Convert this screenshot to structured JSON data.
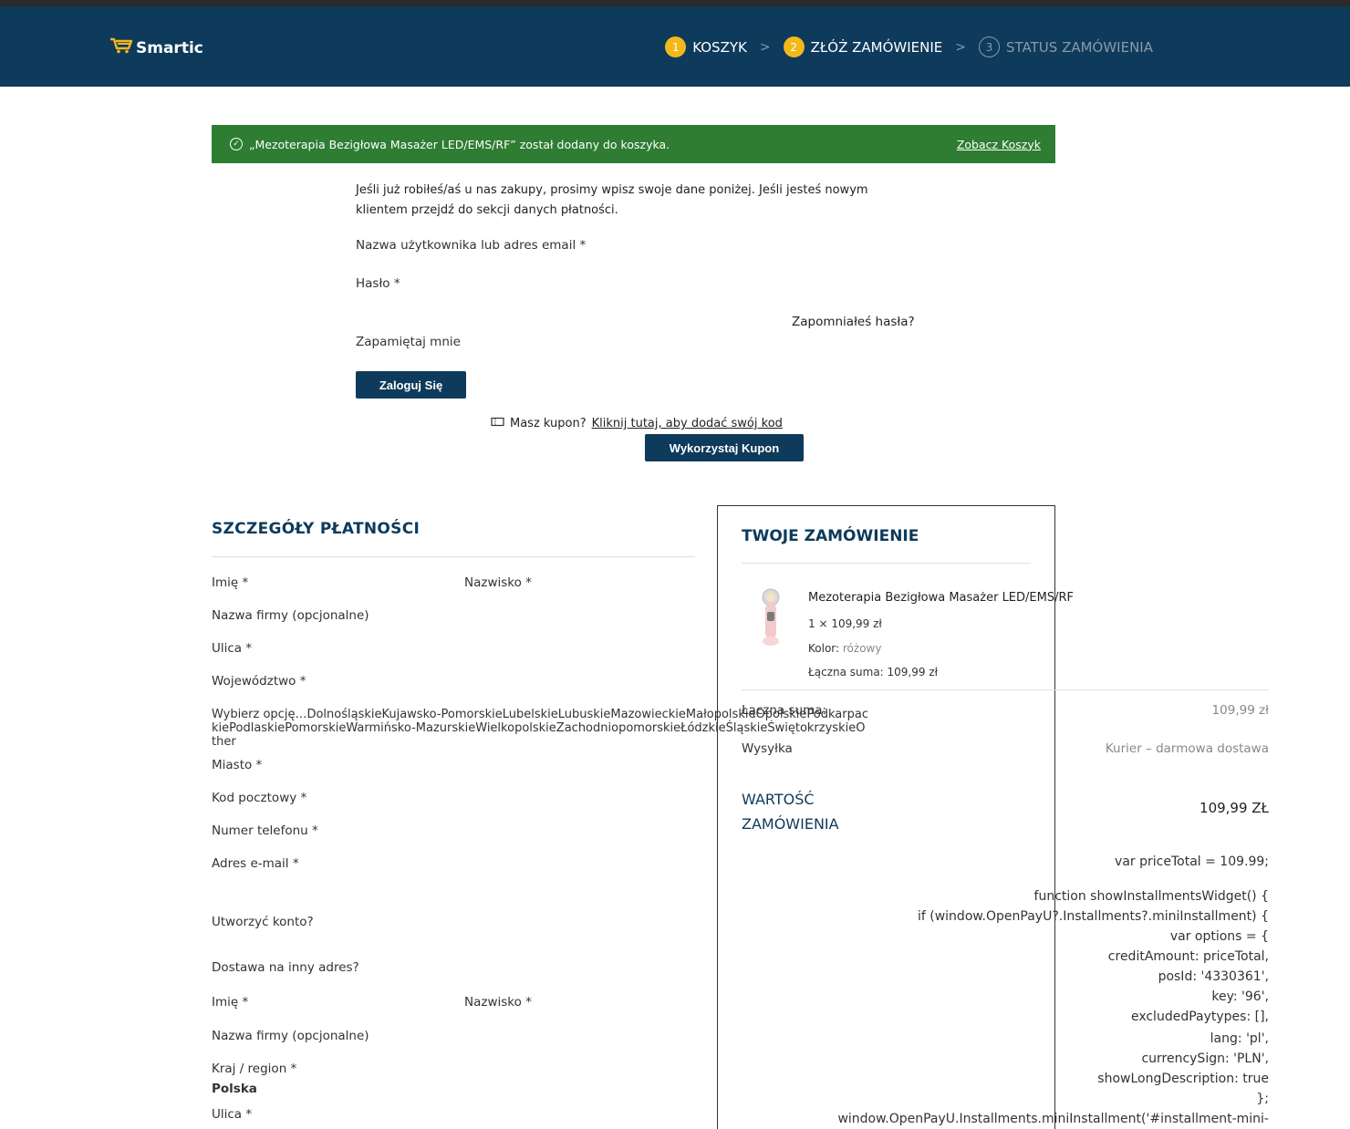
{
  "header": {
    "logo_text": "Smartic",
    "steps": [
      {
        "num": "1",
        "label": "KOSZYK"
      },
      {
        "num": "2",
        "label": "ZŁÓŻ ZAMÓWIENIE"
      },
      {
        "num": "3",
        "label": "STATUS ZAMÓWIENIA"
      }
    ]
  },
  "notice": {
    "message": "„Mezoterapia Bezigłowa Masażer LED/EMS/RF” został dodany do koszyka.",
    "link": "Zobacz Koszyk"
  },
  "login": {
    "intro": "Jeśli już robiłeś/aś u nas zakupy, prosimy wpisz swoje dane poniżej. Jeśli jesteś nowym klientem przejdź do sekcji danych płatności.",
    "username_label": "Nazwa użytkownika lub adres email *",
    "password_label": "Hasło *",
    "forgot": "Zapomniałeś hasła?",
    "remember": "Zapamiętaj mnie",
    "login_button": "Zaloguj Się"
  },
  "coupon": {
    "question": "Masz kupon?",
    "link": "Kliknij tutaj, aby dodać swój kod",
    "button": "Wykorzystaj Kupon"
  },
  "billing": {
    "title": "SZCZEGÓŁY PŁATNOŚCI",
    "first_name": "Imię *",
    "last_name": "Nazwisko *",
    "company": "Nazwa firmy (opcjonalne)",
    "street": "Ulica *",
    "province": "Województwo *",
    "province_options": "Wybierz opcję…DolnośląskieKujawsko-PomorskieLubelskieLubuskieMazowieckieMałopolskieOpolskiePodkarpackiePodlaskiePomorskieWarmińsko-MazurskieWielkopolskieZachodniopomorskieŁódzkieŚląskieŚwiętokrzyskieOther",
    "city": "Miasto *",
    "postcode": "Kod pocztowy *",
    "phone": "Numer telefonu *",
    "email": "Adres e-mail *",
    "create_account": "Utworzyć konto?",
    "ship_other": "Dostawa na inny adres?"
  },
  "shipping": {
    "first_name": "Imię *",
    "last_name": "Nazwisko *",
    "company": "Nazwa firmy (opcjonalne)",
    "country_label": "Kraj / region *",
    "country_value": "Polska",
    "street": "Ulica *"
  },
  "order": {
    "title": "TWOJE ZAMÓWIENIE",
    "product_name": "Mezoterapia Bezigłowa Masażer LED/EMS/RF",
    "qty_price": "1 × 109,99 zł",
    "color_label": "Kolor:",
    "color_value": "różowy",
    "line_total": "Łączna suma: 109,99 zł",
    "subtotal_label": "Łączna suma:",
    "subtotal_value": "109,99 zł",
    "shipping_label": "Wysyłka",
    "shipping_value": "Kurier – darmowa dostawa",
    "total_label_1": "WARTOŚĆ",
    "total_label_2": "ZAMÓWIENIA",
    "total_value": "109,99 ZŁ"
  },
  "script_text": [
    "var priceTotal = 109.99;",
    "",
    "function showInstallmentsWidget() {",
    "if (window.OpenPayU?.Installments?.miniInstallment) {",
    "var options = {",
    "creditAmount: priceTotal,",
    "posId: '4330361',",
    "key: '96',",
    "excludedPaytypes: [],",
    "lang: 'pl',",
    "currencySign: 'PLN',",
    "showLongDescription: true",
    "};",
    "window.OpenPayU.Installments.miniInstallment('#installment-mini-"
  ]
}
